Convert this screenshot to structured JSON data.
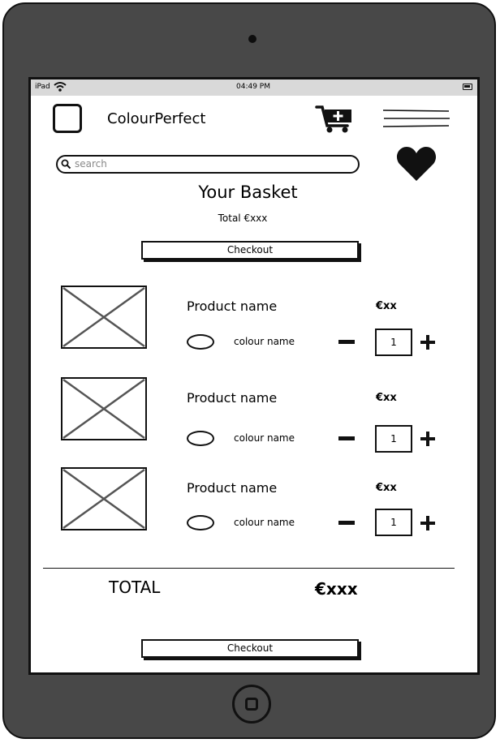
{
  "status_bar": {
    "device": "iPad",
    "time": "04:49 PM"
  },
  "header": {
    "brand": "ColourPerfect",
    "logo_icon": "logo-placeholder-icon",
    "cart_icon": "cart-add-icon",
    "menu_icon": "hamburger-menu-icon",
    "favourite_icon": "heart-icon"
  },
  "search": {
    "placeholder": "search"
  },
  "basket": {
    "title": "Your Basket",
    "total_line": "Total €xxx",
    "checkout_label": "Checkout"
  },
  "items": [
    {
      "name": "Product name",
      "price": "€xx",
      "colour": "colour name",
      "quantity": "1"
    },
    {
      "name": "Product name",
      "price": "€xx",
      "colour": "colour name",
      "quantity": "1"
    },
    {
      "name": "Product name",
      "price": "€xx",
      "colour": "colour name",
      "quantity": "1"
    }
  ],
  "summary": {
    "total_label": "TOTAL",
    "total_value": "€xxx",
    "checkout_label": "Checkout"
  }
}
